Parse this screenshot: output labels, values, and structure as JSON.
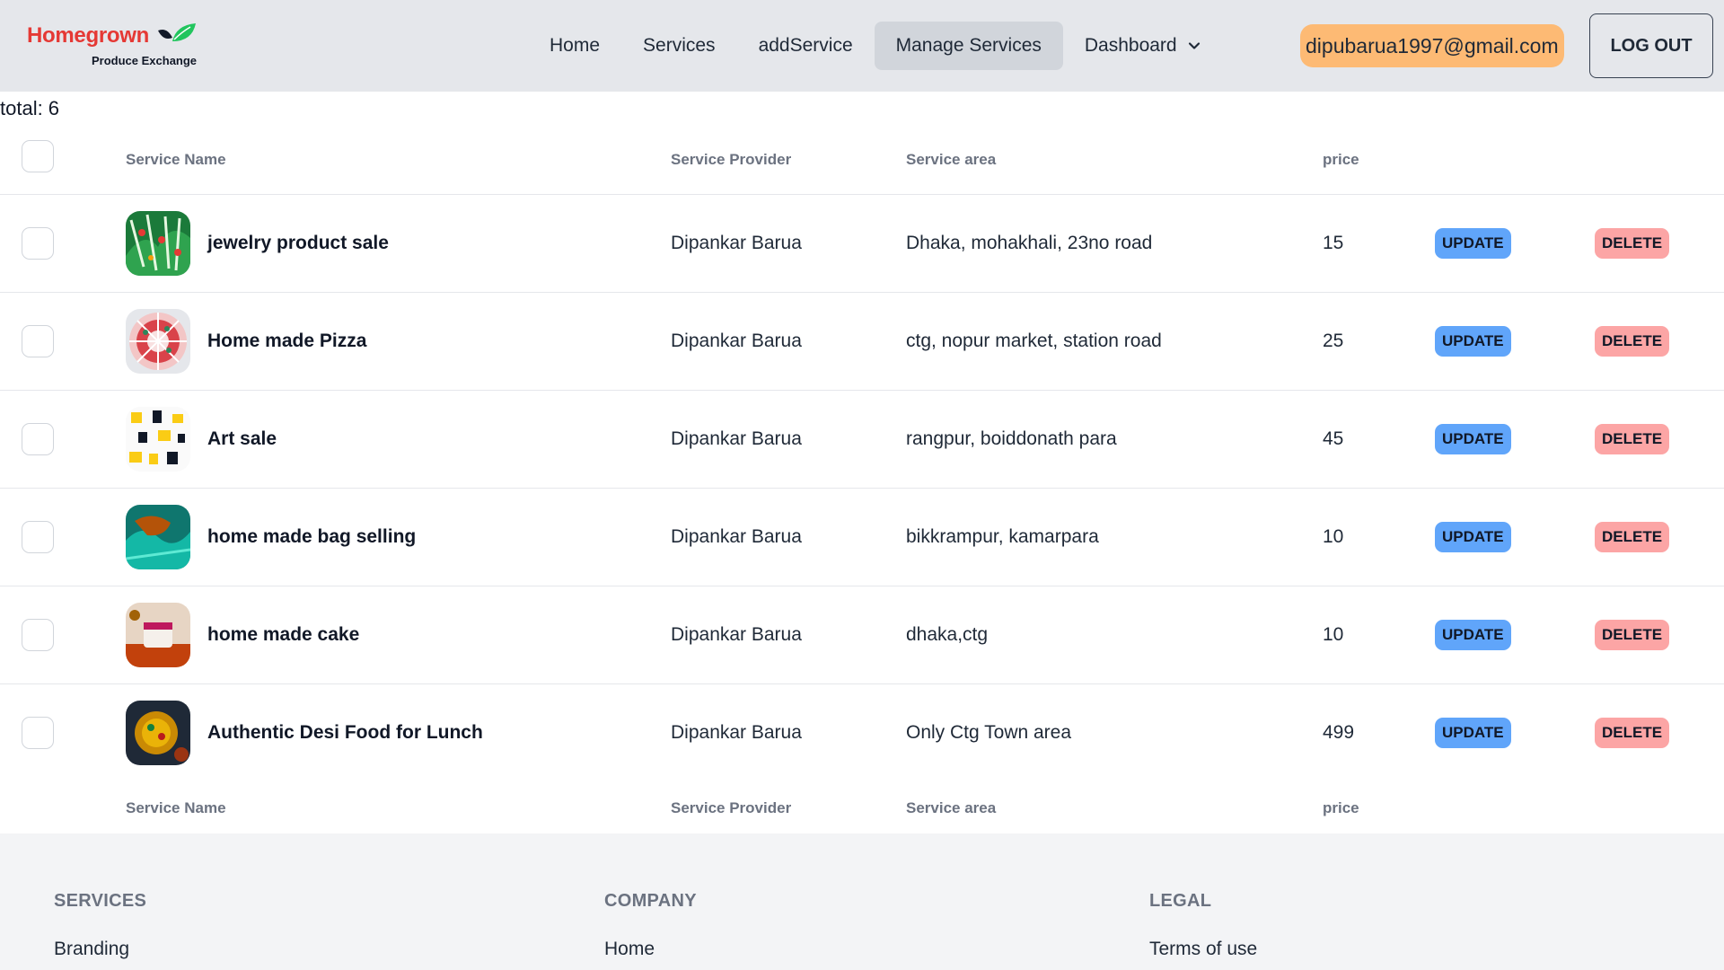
{
  "brand": {
    "name": "Homegrown",
    "tagline": "Produce Exchange",
    "color": "#e53935",
    "leaf_color": "#22c55e"
  },
  "nav": {
    "links": [
      {
        "label": "Home"
      },
      {
        "label": "Services"
      },
      {
        "label": "addService"
      },
      {
        "label": "Manage Services",
        "active": true
      },
      {
        "label": "Dashboard",
        "icon": "chevron-down-icon"
      }
    ],
    "email": "dipubarua1997@gmail.com",
    "logout_label": "LOG OUT"
  },
  "summary": {
    "total_label": "total: 6"
  },
  "table": {
    "headers": {
      "name": "Service Name",
      "provider": "Service Provider",
      "area": "Service area",
      "price": "price"
    },
    "update_label": "UPDATE",
    "delete_label": "DELETE",
    "rows": [
      {
        "name": "jewelry product sale",
        "provider": "Dipankar Barua",
        "area": "Dhaka, mohakhali, 23no road",
        "price": "15"
      },
      {
        "name": "Home made Pizza",
        "provider": "Dipankar Barua",
        "area": "ctg, nopur market, station road",
        "price": "25"
      },
      {
        "name": "Art sale",
        "provider": "Dipankar Barua",
        "area": "rangpur, boiddonath para",
        "price": "45"
      },
      {
        "name": "home made bag selling",
        "provider": "Dipankar Barua",
        "area": "bikkrampur, kamarpara",
        "price": "10"
      },
      {
        "name": "home made cake",
        "provider": "Dipankar Barua",
        "area": "dhaka,ctg",
        "price": "10"
      },
      {
        "name": "Authentic Desi Food for Lunch",
        "provider": "Dipankar Barua",
        "area": "Only Ctg Town area",
        "price": "499"
      }
    ]
  },
  "footer": {
    "columns": [
      {
        "heading": "SERVICES",
        "link": "Branding"
      },
      {
        "heading": "COMPANY",
        "link": "Home"
      },
      {
        "heading": "LEGAL",
        "link": "Terms of use"
      }
    ]
  },
  "colors": {
    "navbar_bg": "#e5e7eb",
    "update_bg": "#60a5fa",
    "delete_bg": "#fca5a5",
    "email_bg": "#fdba74",
    "footer_bg": "#f3f4f6"
  }
}
